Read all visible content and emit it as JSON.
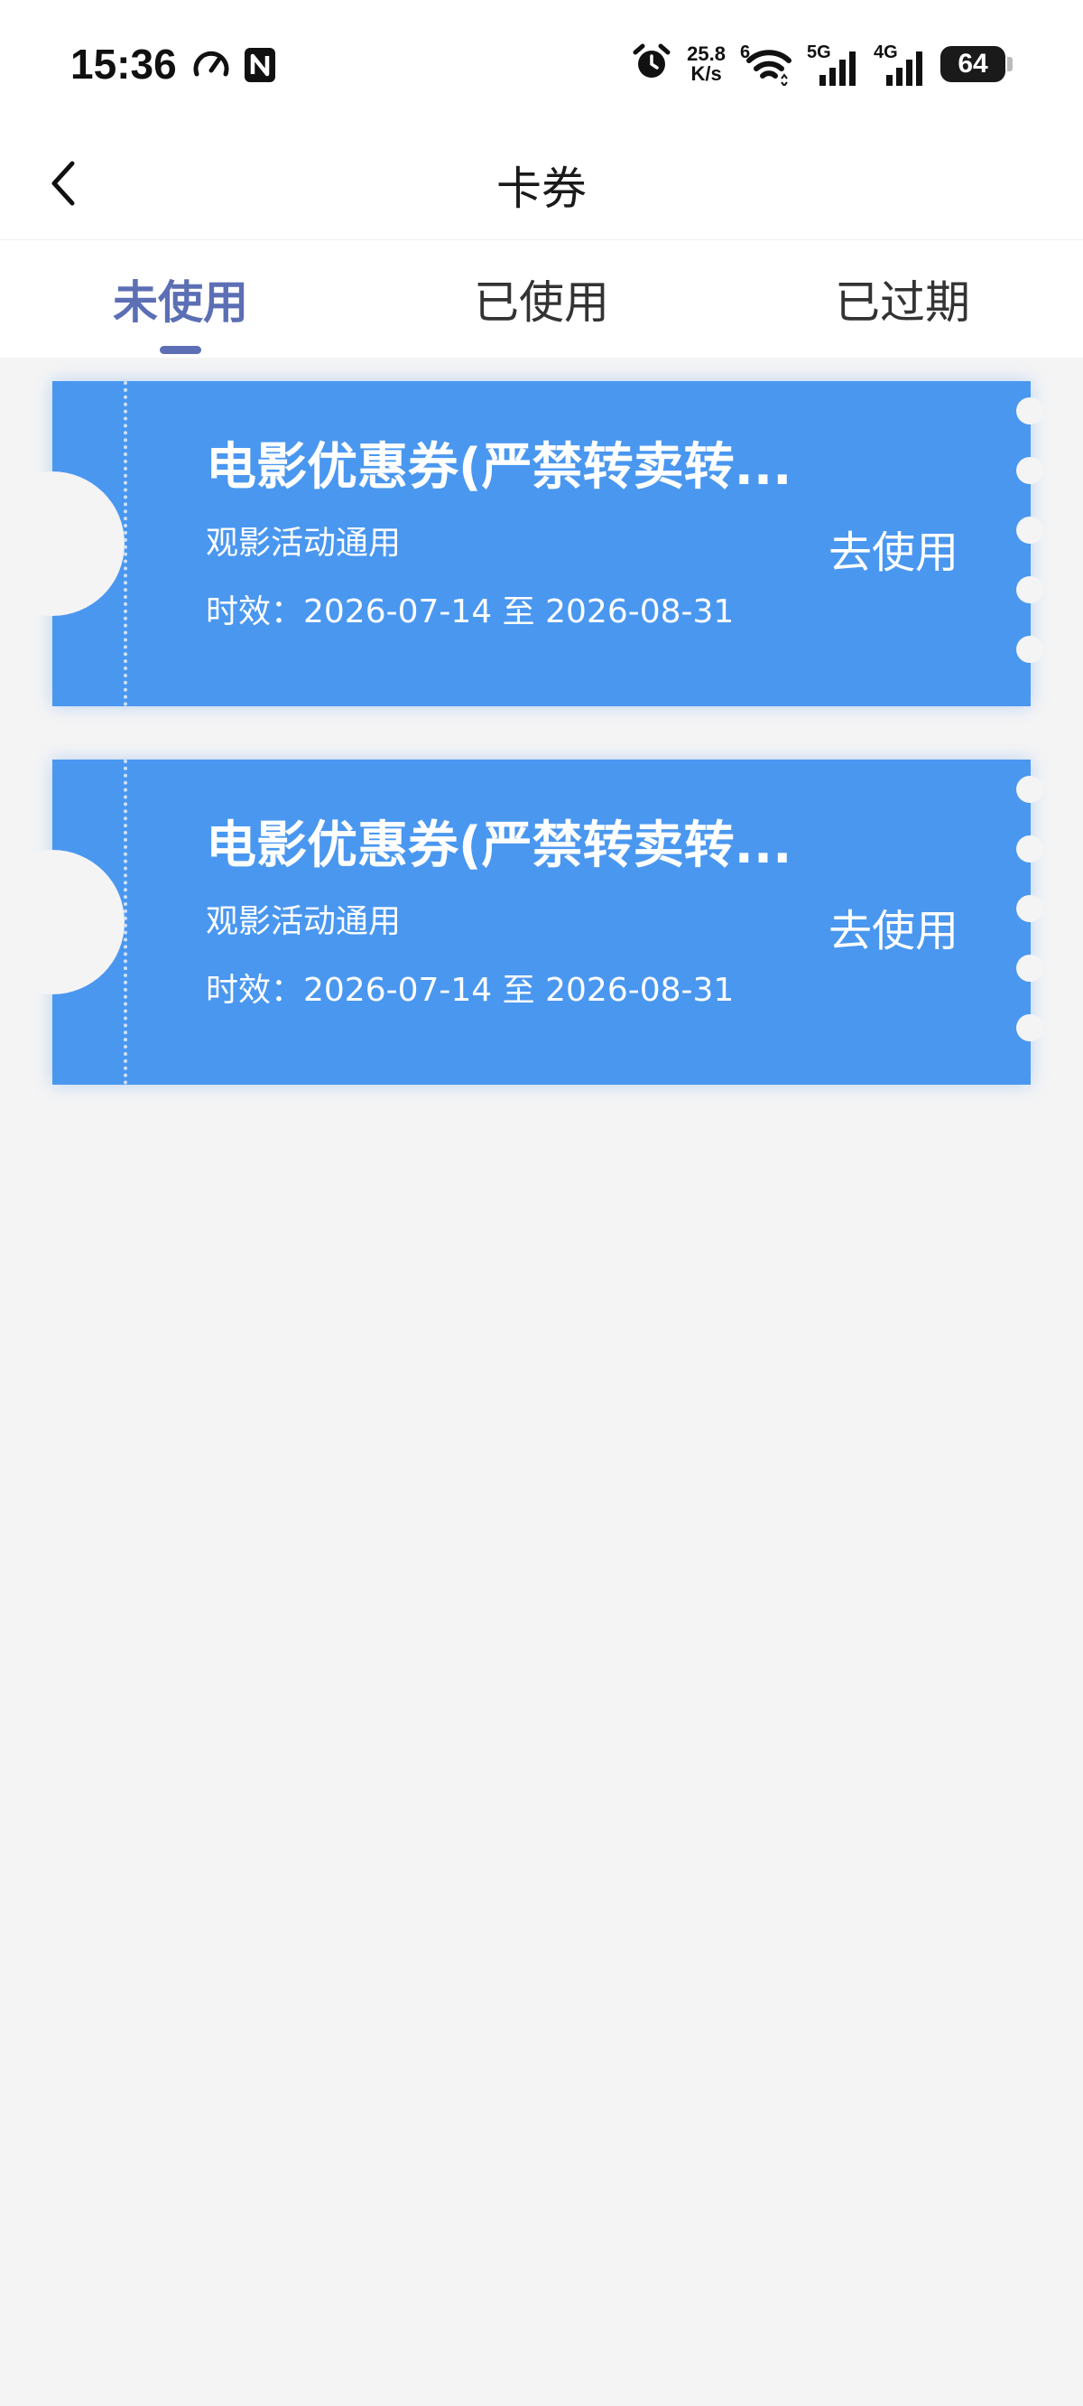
{
  "status_bar": {
    "time": "15:36",
    "net_speed_value": "25.8",
    "net_speed_unit": "K/s",
    "wifi_label": "6",
    "signal1_label": "5G",
    "signal2_label": "4G",
    "battery": "64"
  },
  "header": {
    "title": "卡券"
  },
  "tabs": [
    {
      "label": "未使用",
      "active": true
    },
    {
      "label": "已使用",
      "active": false
    },
    {
      "label": "已过期",
      "active": false
    }
  ],
  "coupons": [
    {
      "title": "电影优惠券(严禁转卖转...",
      "description": "观影活动通用",
      "validity": "时效：2026-07-14 至 2026-08-31",
      "action_label": "去使用"
    },
    {
      "title": "电影优惠券(严禁转卖转...",
      "description": "观影活动通用",
      "validity": "时效：2026-07-14 至 2026-08-31",
      "action_label": "去使用"
    }
  ],
  "colors": {
    "accent": "#5c6fb5",
    "coupon_bg": "#4a97f0",
    "page_bg": "#f4f4f5"
  }
}
